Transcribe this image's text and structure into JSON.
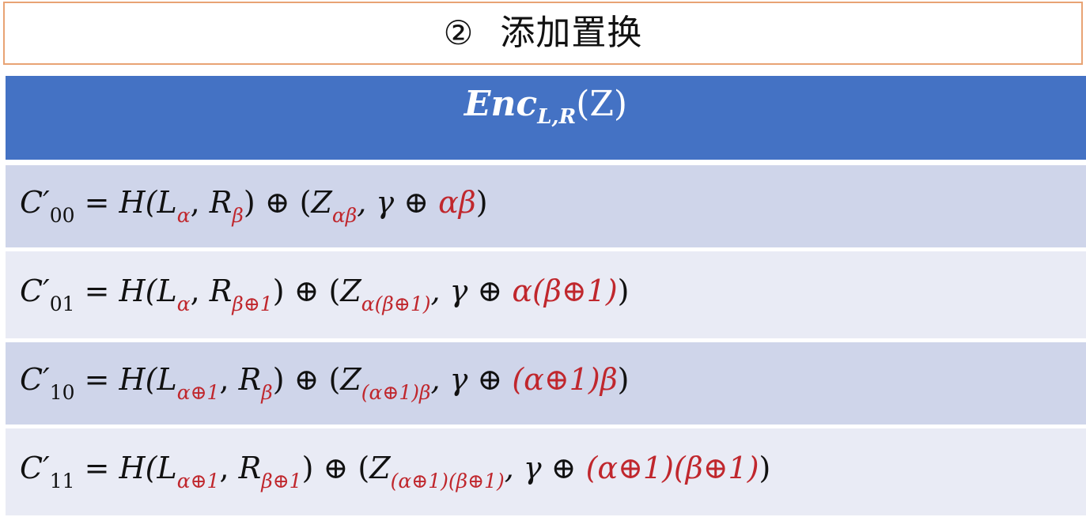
{
  "title": {
    "number": "②",
    "text": "添加置换"
  },
  "header": {
    "enc_main": "Enc",
    "enc_sub": "L,R",
    "enc_arg": "(Z)"
  },
  "rows": [
    {
      "c_sub": "00",
      "l_sub": "α",
      "r_sub": "β",
      "z_sub": "αβ",
      "rhs": "αβ"
    },
    {
      "c_sub": "01",
      "l_sub": "α",
      "r_sub": "β⊕1",
      "z_sub": "α(β⊕1)",
      "rhs": "α(β⊕1)"
    },
    {
      "c_sub": "10",
      "l_sub": "α⊕1",
      "r_sub": "β",
      "z_sub": "(α⊕1)β",
      "rhs": "(α⊕1)β"
    },
    {
      "c_sub": "11",
      "l_sub": "α⊕1",
      "r_sub": "β⊕1",
      "z_sub": "(α⊕1)(β⊕1)",
      "rhs": "(α⊕1)(β⊕1)"
    }
  ],
  "symbols": {
    "c": "C′",
    "eq": " = ",
    "h_open": "H(",
    "l": "L",
    "comma": ", ",
    "r": "R",
    "close_xor_open": ") ⊕ (",
    "z": "Z",
    "gamma_xor": ", γ ⊕ ",
    "close": ")"
  },
  "colors": {
    "title_border": "#e8a374",
    "header_bg": "#4472c4",
    "row_dark": "#cfd5ea",
    "row_light": "#e9ebf5",
    "highlight_red": "#c0272d"
  }
}
